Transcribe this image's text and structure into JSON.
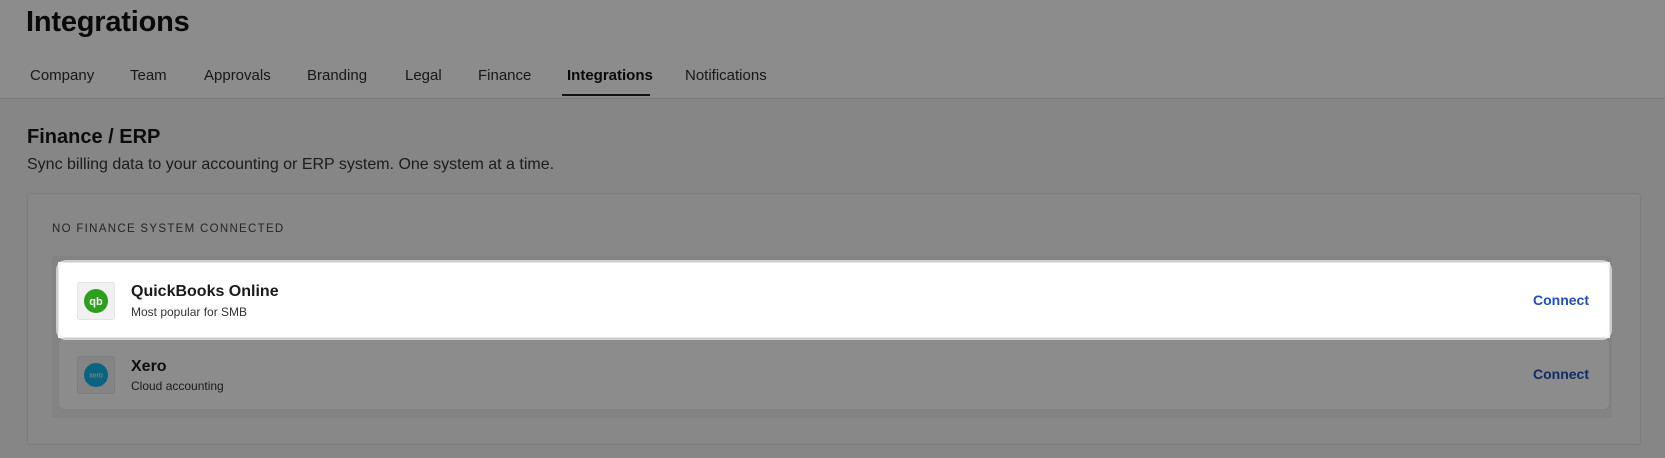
{
  "page": {
    "title": "Integrations"
  },
  "tabs": [
    {
      "label": "Company"
    },
    {
      "label": "Team"
    },
    {
      "label": "Approvals"
    },
    {
      "label": "Branding"
    },
    {
      "label": "Legal"
    },
    {
      "label": "Finance"
    },
    {
      "label": "Integrations",
      "active": true
    },
    {
      "label": "Notifications"
    }
  ],
  "finance_section": {
    "title": "Finance / ERP",
    "description": "Sync billing data to your accounting or ERP system. One system at a time.",
    "status": "NO FINANCE SYSTEM CONNECTED",
    "integrations": [
      {
        "name": "QuickBooks Online",
        "subtitle": "Most popular for SMB",
        "action": "Connect",
        "icon": "quickbooks-logo-icon",
        "icon_color": "#2ca01c",
        "highlighted": true
      },
      {
        "name": "Xero",
        "subtitle": "Cloud accounting",
        "action": "Connect",
        "icon": "xero-logo-icon",
        "icon_color": "#13b5ea",
        "highlighted": false
      }
    ]
  },
  "colors": {
    "link": "#1f4ec2",
    "overlay": "rgba(0,0,0,0.45)"
  }
}
